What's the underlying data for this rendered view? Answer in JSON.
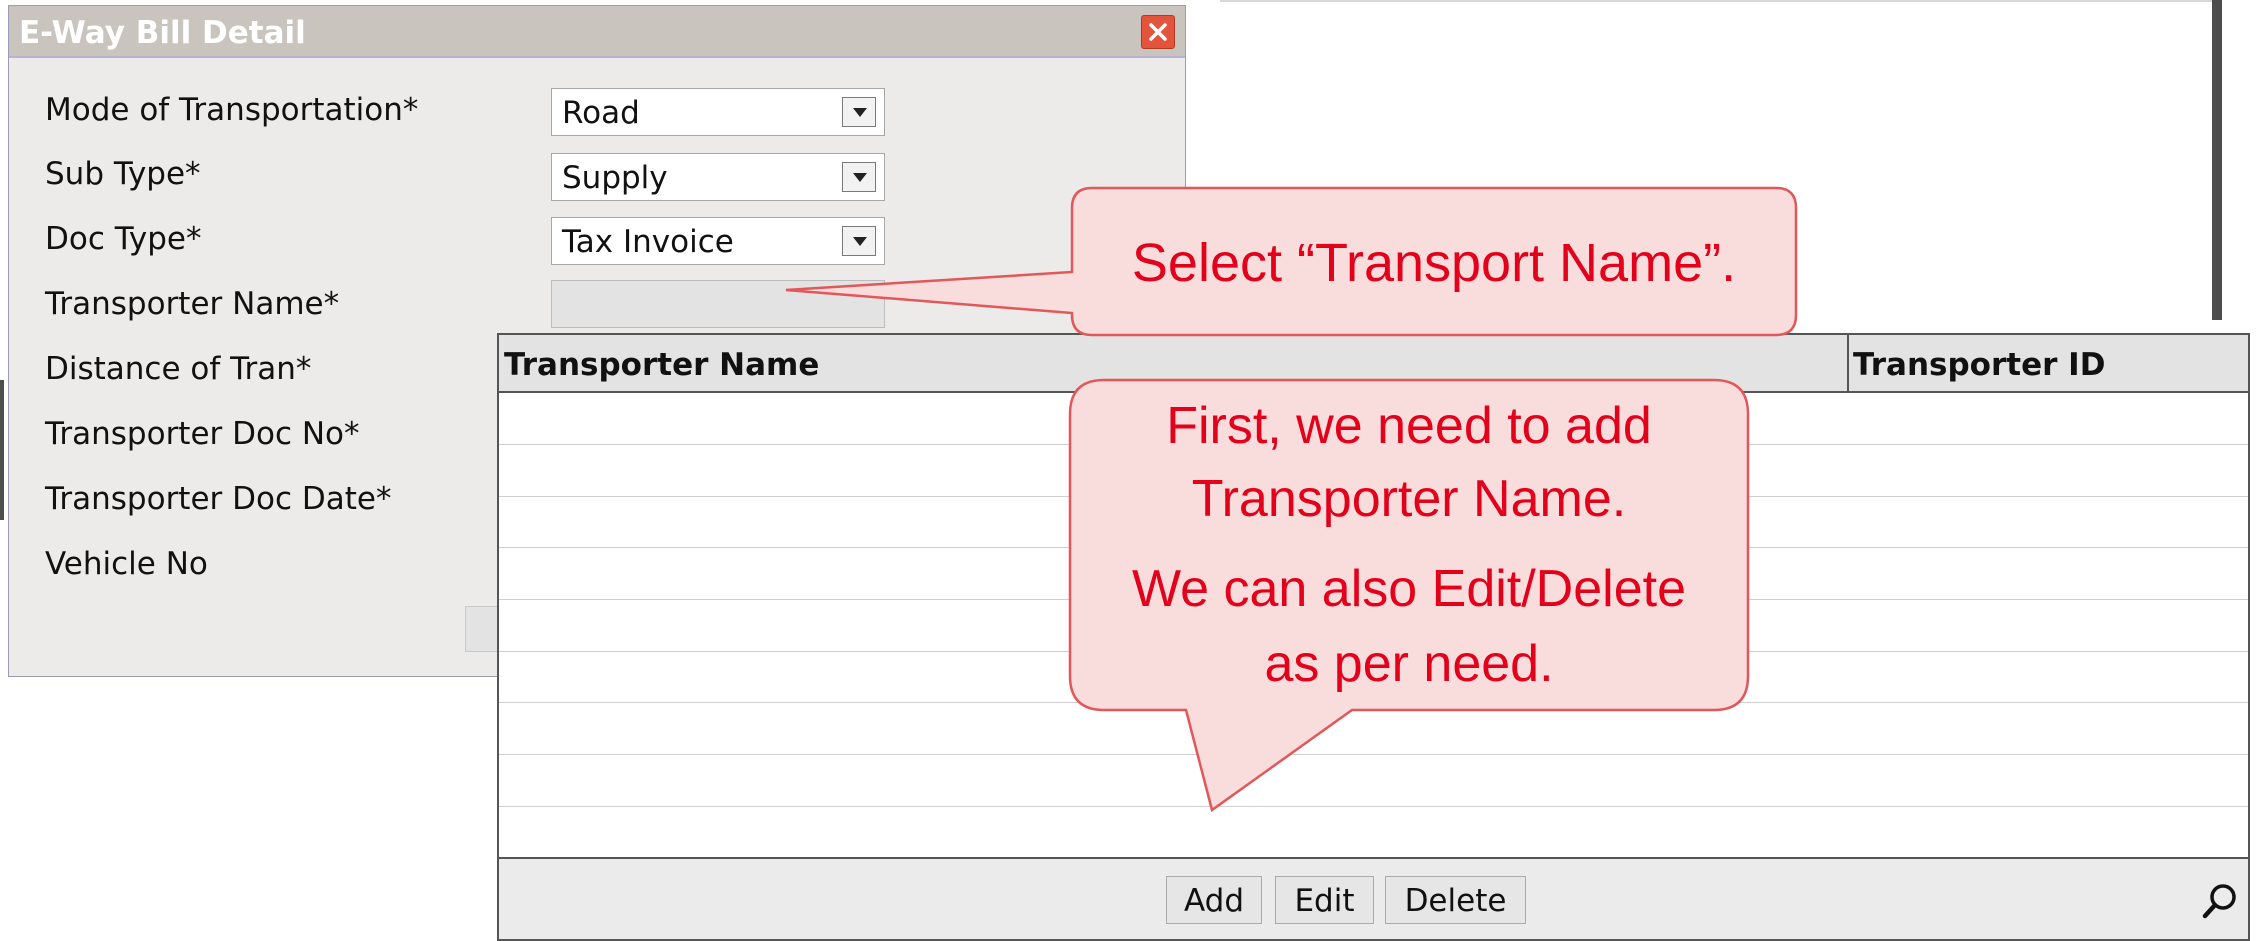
{
  "dialog": {
    "title": "E-Way Bill Detail",
    "fields": [
      {
        "label": "Mode of Transportation*",
        "value": "Road"
      },
      {
        "label": "Sub Type*",
        "value": "Supply"
      },
      {
        "label": "Doc Type*",
        "value": "Tax Invoice"
      },
      {
        "label": "Transporter Name*",
        "value": ""
      },
      {
        "label": "Distance of Tran*"
      },
      {
        "label": "Transporter Doc No*"
      },
      {
        "label": "Transporter Doc Date*"
      },
      {
        "label": "Vehicle No"
      }
    ]
  },
  "lookup": {
    "columns": [
      "Transporter Name",
      "Transporter ID"
    ],
    "buttons": {
      "add": "Add",
      "edit": "Edit",
      "delete": "Delete"
    },
    "search_icon": "search-icon"
  },
  "callouts": {
    "select_hint": "Select “Transport Name”.",
    "add_hint_line1": "First, we need to add",
    "add_hint_line2": "Transporter Name.",
    "add_hint_line3": "We can also Edit/Delete",
    "add_hint_line4": "as per need."
  },
  "colors": {
    "callout_fill": "#f9dcdc",
    "callout_border": "#e2575a",
    "callout_text": "#e3001b",
    "close_button": "#e2543b"
  }
}
